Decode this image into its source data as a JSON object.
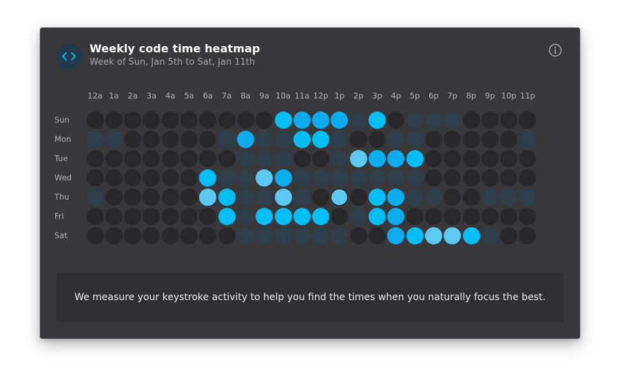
{
  "header": {
    "title": "Weekly code time heatmap",
    "subtitle": "Week of Sun, Jan 5th to Sat, Jan 11th",
    "logo_icon": "code-brackets-icon",
    "info_icon": "info-icon"
  },
  "hours": [
    "12a",
    "1a",
    "2a",
    "3a",
    "4a",
    "5a",
    "6a",
    "7a",
    "8a",
    "9a",
    "10a",
    "11a",
    "12p",
    "1p",
    "2p",
    "3p",
    "4p",
    "5p",
    "6p",
    "7p",
    "8p",
    "9p",
    "10p",
    "11p"
  ],
  "days": [
    "Sun",
    "Mon",
    "Tue",
    "Wed",
    "Thu",
    "Fri",
    "Sat"
  ],
  "levels": {
    "0": "#28282a",
    "1": "#2e3f4b",
    "2": "#5ccaf5",
    "3": "#02bff8",
    "4": "#0aaef0"
  },
  "grid": [
    [
      0,
      0,
      0,
      0,
      0,
      0,
      0,
      0,
      0,
      0,
      3,
      4,
      4,
      4,
      1,
      3,
      0,
      1,
      1,
      1,
      0,
      0,
      0,
      0
    ],
    [
      1,
      1,
      0,
      0,
      0,
      0,
      0,
      1,
      4,
      1,
      1,
      3,
      3,
      1,
      0,
      0,
      1,
      1,
      0,
      0,
      0,
      0,
      0,
      1
    ],
    [
      0,
      0,
      0,
      0,
      0,
      0,
      0,
      0,
      1,
      1,
      1,
      0,
      0,
      1,
      2,
      4,
      4,
      3,
      0,
      0,
      0,
      0,
      0,
      0
    ],
    [
      0,
      0,
      0,
      0,
      0,
      0,
      3,
      1,
      1,
      2,
      4,
      1,
      1,
      1,
      1,
      1,
      1,
      1,
      0,
      0,
      0,
      0,
      0,
      0
    ],
    [
      1,
      0,
      0,
      0,
      0,
      0,
      2,
      3,
      1,
      1,
      2,
      1,
      0,
      2,
      0,
      3,
      4,
      1,
      1,
      0,
      0,
      1,
      1,
      1
    ],
    [
      0,
      0,
      0,
      0,
      0,
      0,
      0,
      3,
      1,
      3,
      3,
      3,
      3,
      0,
      1,
      3,
      4,
      0,
      0,
      0,
      0,
      0,
      0,
      0
    ],
    [
      0,
      0,
      0,
      0,
      0,
      0,
      0,
      0,
      1,
      1,
      1,
      1,
      1,
      1,
      0,
      0,
      4,
      3,
      2,
      2,
      3,
      1,
      0,
      0
    ]
  ],
  "selected_cell": {
    "day": "Thu",
    "hour": "1p"
  },
  "footer": {
    "text": "We measure your keystroke activity to help you find the times when you naturally focus the best."
  }
}
